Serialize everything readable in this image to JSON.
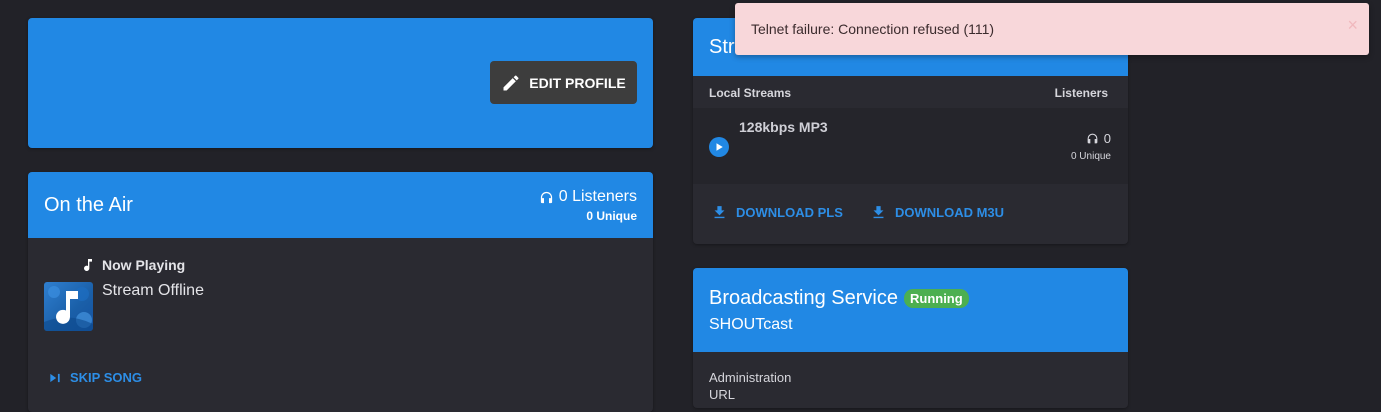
{
  "profile": {
    "edit_label": "EDIT PROFILE"
  },
  "on_air": {
    "title": "On the Air",
    "listeners": "0 Listeners",
    "unique": "0 Unique",
    "now_playing_label": "Now Playing",
    "song": "Stream Offline",
    "skip_label": "SKIP SONG"
  },
  "streams": {
    "title": "Streams",
    "col_local": "Local Streams",
    "col_listeners": "Listeners",
    "items": [
      {
        "name": "128kbps MP3",
        "listeners": "0",
        "unique": "0 Unique"
      }
    ],
    "download_pls": "DOWNLOAD PLS",
    "download_m3u": "DOWNLOAD M3U"
  },
  "broadcast": {
    "title": "Broadcasting Service",
    "status": "Running",
    "server": "SHOUTcast",
    "admin_label": "Administration",
    "url_label": "URL"
  },
  "alert": {
    "message": "Telnet failure: Connection refused (111)",
    "close": "×"
  },
  "colors": {
    "accent": "#2188e4",
    "background": "#222228",
    "card": "#2a2a31",
    "alert_bg": "#f8d7da",
    "badge_running": "#4caf50",
    "link": "#2d8ee6"
  },
  "icons": [
    "pencil-icon",
    "headphones-icon",
    "music-note-icon",
    "skip-next-icon",
    "play-circle-icon",
    "download-icon",
    "close-icon"
  ]
}
